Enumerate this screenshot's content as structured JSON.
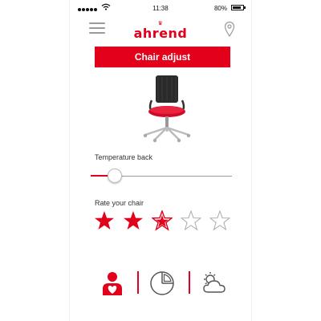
{
  "status_bar": {
    "time": "11:38",
    "battery_text": "80%",
    "battery_level": 0.8
  },
  "header": {
    "logo_text": "ahrend",
    "menu_icon": "hamburger-menu-icon",
    "location_icon": "map-pin-icon"
  },
  "main": {
    "primary_button_label": "Chair adjust",
    "temperature_label": "Temperature back",
    "temperature_level": 0.16,
    "rating_label": "Rate your chair",
    "rating_value": 2.5,
    "rating_max": 5
  },
  "tabbar": {
    "tabs": [
      {
        "icon": "user-heart-icon",
        "active": true
      },
      {
        "icon": "pie-chart-icon",
        "active": false
      },
      {
        "icon": "weather-cloud-sun-icon",
        "active": false
      }
    ]
  },
  "colors": {
    "accent": "#e2001a",
    "inactive_icon": "#555555"
  }
}
